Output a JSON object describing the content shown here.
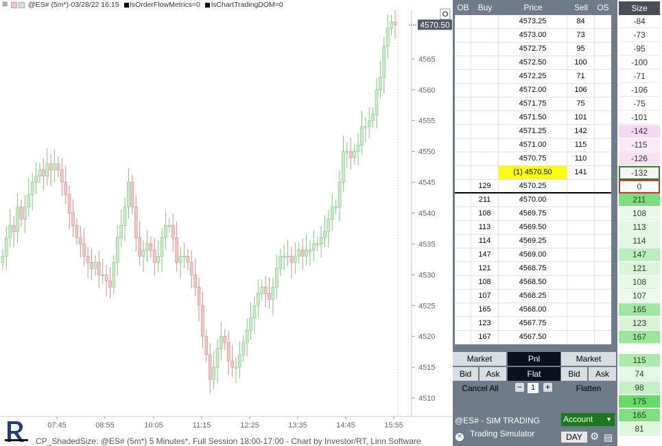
{
  "chart": {
    "header": {
      "title": "@ES# (5m*)-03/28/22 16:15",
      "indicator1": "lsOrderFlowMetrics=0",
      "indicator2": "lsChartTradingDOM=0"
    },
    "last_price_label": "4570.50",
    "marker_label": "O",
    "y_ticks": [
      "4565",
      "4560",
      "4555",
      "4550",
      "4545",
      "4540",
      "4535",
      "4530",
      "4525",
      "4520",
      "4515",
      "4510"
    ],
    "x_ticks": [
      "07:45",
      "08:55",
      "10:05",
      "11:15",
      "12:25",
      "13:35",
      "14:45",
      "15:55"
    ],
    "footer": "CP_ShadedSize: @ES# (5m*) 5 Minutes*, Full Session 18:00-17:00 - Chart by Investor/RT, Linn Software",
    "colors": {
      "up": "#c6ecc6",
      "down": "#f2c4c4",
      "up_wick": "#7cc47c",
      "down_wick": "#d48a8a"
    }
  },
  "chart_data": {
    "type": "candlestick",
    "title": "@ES# (5m*)-03/28/22 16:15",
    "ylim": [
      4507,
      4573
    ],
    "x_ticks": [
      "07:45",
      "08:55",
      "10:05",
      "11:15",
      "12:25",
      "13:35",
      "14:45",
      "15:55"
    ],
    "last": 4570.5,
    "closes": [
      4533,
      4536,
      4538,
      4537,
      4541,
      4539,
      4541,
      4543,
      4545,
      4546,
      4547,
      4546,
      4548,
      4547,
      4548,
      4547,
      4545,
      4543,
      4540,
      4538,
      4536,
      4535,
      4533,
      4532,
      4531,
      4532,
      4530,
      4530,
      4529,
      4528,
      4532,
      4536,
      4538,
      4541,
      4545,
      4541,
      4536,
      4533,
      4534,
      4535,
      4534,
      4532,
      4533,
      4536,
      4538,
      4538,
      4536,
      4532,
      4533,
      4533,
      4532,
      4530,
      4528,
      4525,
      4520,
      4517,
      4513,
      4515,
      4518,
      4520,
      4519,
      4516,
      4515,
      4515,
      4517,
      4519,
      4521,
      4523,
      4525,
      4527,
      4528,
      4527,
      4526,
      4528,
      4531,
      4533,
      4533,
      4533,
      4532,
      4533,
      4534,
      4533,
      4534,
      4534,
      4535,
      4535,
      4536,
      4537,
      4539,
      4541,
      4541,
      4545,
      4550,
      4550,
      4549,
      4550,
      4551,
      4554,
      4554,
      4555,
      4556,
      4560,
      4562,
      4567,
      4570,
      4571,
      4570.5
    ]
  },
  "dom": {
    "headers": {
      "ob": "OB",
      "buy": "Buy",
      "price": "Price",
      "sell": "Sell",
      "os": "OS"
    },
    "rows": [
      {
        "buy": "",
        "price": "4573.25",
        "sell": "84"
      },
      {
        "buy": "",
        "price": "4573.00",
        "sell": "73"
      },
      {
        "buy": "",
        "price": "4572.75",
        "sell": "95"
      },
      {
        "buy": "",
        "price": "4572.50",
        "sell": "100"
      },
      {
        "buy": "",
        "price": "4572.25",
        "sell": "71"
      },
      {
        "buy": "",
        "price": "4572.00",
        "sell": "106"
      },
      {
        "buy": "",
        "price": "4571.75",
        "sell": "75"
      },
      {
        "buy": "",
        "price": "4571.50",
        "sell": "101"
      },
      {
        "buy": "",
        "price": "4571.25",
        "sell": "142"
      },
      {
        "buy": "",
        "price": "4571.00",
        "sell": "115"
      },
      {
        "buy": "",
        "price": "4570.75",
        "sell": "110"
      },
      {
        "buy": "",
        "price": "(1) 4570.50",
        "sell": "141",
        "last": true
      },
      {
        "buy": "129",
        "price": "4570.25",
        "sell": ""
      },
      {
        "buy": "211",
        "price": "4570.00",
        "sell": ""
      },
      {
        "buy": "108",
        "price": "4569.75",
        "sell": ""
      },
      {
        "buy": "113",
        "price": "4569.50",
        "sell": ""
      },
      {
        "buy": "114",
        "price": "4569.25",
        "sell": ""
      },
      {
        "buy": "147",
        "price": "4569.00",
        "sell": ""
      },
      {
        "buy": "121",
        "price": "4568.75",
        "sell": ""
      },
      {
        "buy": "108",
        "price": "4568.50",
        "sell": ""
      },
      {
        "buy": "107",
        "price": "4568.25",
        "sell": ""
      },
      {
        "buy": "165",
        "price": "4568.00",
        "sell": ""
      },
      {
        "buy": "123",
        "price": "4567.75",
        "sell": ""
      },
      {
        "buy": "167",
        "price": "4567.50",
        "sell": ""
      }
    ],
    "buttons": {
      "market_buy": "Market",
      "pnl": "Pnl",
      "market_sell": "Market",
      "bid_buy": "Bid",
      "ask_buy": "Ask",
      "flat": "Flat",
      "bid_sell": "Bid",
      "ask_sell": "Ask",
      "cancel_all": "Cancel All",
      "quantity": "1",
      "flatten": "Flatten"
    },
    "symbol": "@ES# - SIM TRADING",
    "account_type": "Trading Simulator",
    "account_label": "Account",
    "tif": "DAY"
  },
  "size": {
    "header": "Size",
    "upper": [
      {
        "value": "-84",
        "bg": "#ffffff"
      },
      {
        "value": "-73",
        "bg": "#ffffff"
      },
      {
        "value": "-95",
        "bg": "#ffffff"
      },
      {
        "value": "-100",
        "bg": "#ffffff"
      },
      {
        "value": "-71",
        "bg": "#ffffff"
      },
      {
        "value": "-106",
        "bg": "#ffffff"
      },
      {
        "value": "-75",
        "bg": "#ffffff"
      },
      {
        "value": "-101",
        "bg": "#ffffff"
      },
      {
        "value": "-142",
        "bg": "#f7d8f0"
      },
      {
        "value": "-115",
        "bg": "#fbeaf7"
      },
      {
        "value": "-126",
        "bg": "#f9e0f3"
      },
      {
        "value": "-132",
        "bg": "#f5f5f5",
        "border": "#2e7d32"
      },
      {
        "value": "0",
        "bg": "#ffffff",
        "border": "#d32f2f"
      },
      {
        "value": "211",
        "bg": "#7be07b"
      },
      {
        "value": "108",
        "bg": "#e8fbe8"
      },
      {
        "value": "113",
        "bg": "#e0f9e0"
      },
      {
        "value": "114",
        "bg": "#e0f9e0"
      },
      {
        "value": "147",
        "bg": "#b6f0b6"
      },
      {
        "value": "121",
        "bg": "#d8f7d8"
      },
      {
        "value": "108",
        "bg": "#e8fbe8"
      },
      {
        "value": "107",
        "bg": "#eafbea"
      },
      {
        "value": "165",
        "bg": "#9ce99c"
      },
      {
        "value": "123",
        "bg": "#d6f6d6"
      },
      {
        "value": "167",
        "bg": "#98e898"
      }
    ],
    "lower": [
      {
        "value": "115",
        "bg": "#a8eca8"
      },
      {
        "value": "74",
        "bg": "#e2fae2"
      },
      {
        "value": "98",
        "bg": "#c2f2c2"
      },
      {
        "value": "175",
        "bg": "#66dc66"
      },
      {
        "value": "165",
        "bg": "#7ce27c"
      },
      {
        "value": "81",
        "bg": "#dcf8dc"
      }
    ]
  }
}
